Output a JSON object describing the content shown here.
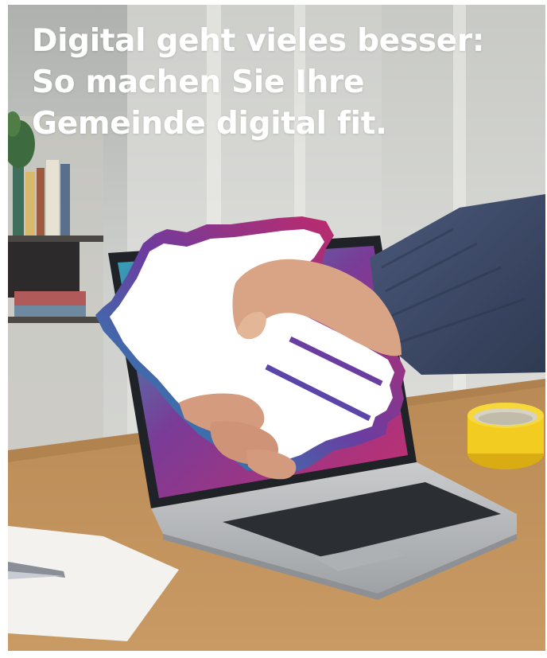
{
  "headline": {
    "line1": "Digital geht vieles besser:",
    "line2": "So machen Sie Ihre",
    "line3": "Gemeinde digital fit."
  },
  "colors": {
    "text": "#ffffff",
    "cursor_gradient_start": "#0fa1b8",
    "cursor_gradient_mid": "#6a3da0",
    "cursor_gradient_end": "#d8245c",
    "sweater": "#3c4a64",
    "mug": "#f2cc20",
    "desk": "#c0925c"
  },
  "image": {
    "subject": "photo",
    "icons": [
      "pixel-hand-cursor-icon"
    ]
  }
}
